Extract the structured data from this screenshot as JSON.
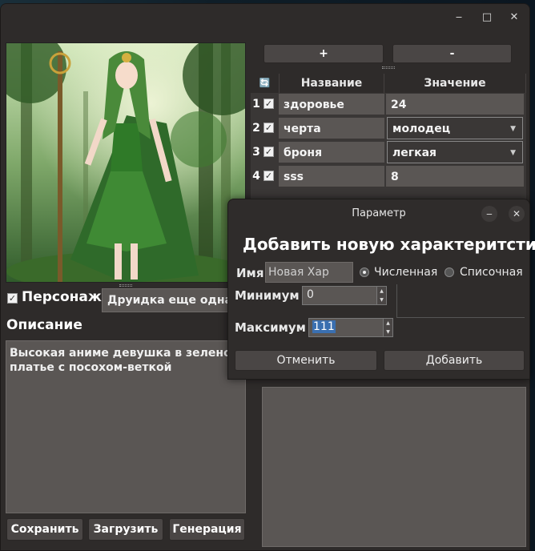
{
  "window": {
    "minimize": "‒",
    "maximize": "□",
    "close": "✕"
  },
  "character": {
    "checked": true,
    "label": "Персонаж",
    "name_value": "Друидка еще одна"
  },
  "description": {
    "label": "Описание",
    "text": "Высокая аниме девушка в зеленом платье с посохом-веткой"
  },
  "footer_buttons": {
    "save": "Сохранить",
    "load": "Загрузить",
    "generate": "Генерация"
  },
  "params": {
    "add_button": "+",
    "remove_button": "-",
    "refresh_icon": "🔄",
    "headers": {
      "name": "Название",
      "value": "Значение"
    },
    "rows": [
      {
        "num": "1",
        "checked": true,
        "name": "здоровье",
        "value": "24",
        "kind": "text"
      },
      {
        "num": "2",
        "checked": true,
        "name": "черта",
        "value": "молодец",
        "kind": "combo"
      },
      {
        "num": "3",
        "checked": true,
        "name": "броня",
        "value": "легкая",
        "kind": "combo"
      },
      {
        "num": "4",
        "checked": true,
        "name": "sss",
        "value": "8",
        "kind": "text"
      }
    ]
  },
  "dialog": {
    "title": "Параметр",
    "heading": "Добавить новую характеритстику",
    "name_label": "Имя",
    "name_value": "Новая Хар",
    "radio_numeric": "Численная",
    "radio_list": "Списочная",
    "selected": "numeric",
    "min_label": "Минимум",
    "min_value": "0",
    "max_label": "Максимум",
    "max_value": "111",
    "cancel": "Отменить",
    "add": "Добавить"
  },
  "colors": {
    "window_bg": "#2e2b2a",
    "field_bg": "#5a5654",
    "button_bg": "#4a4645",
    "accent_green": "#3d7a2a"
  }
}
